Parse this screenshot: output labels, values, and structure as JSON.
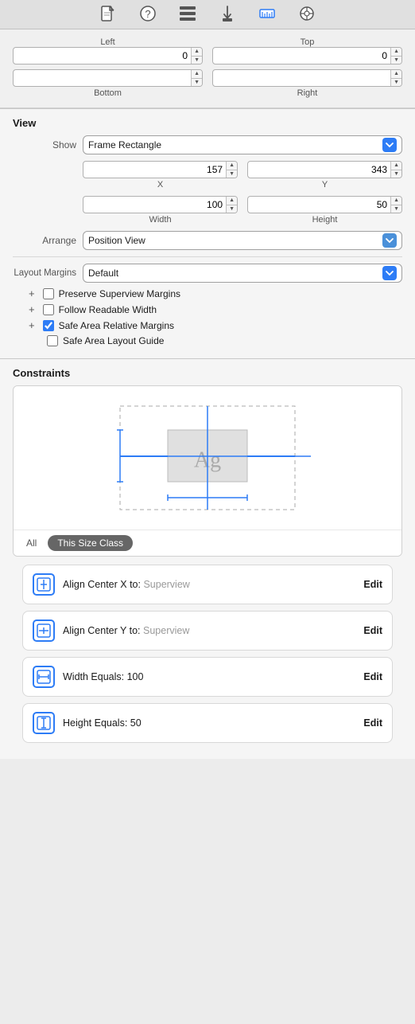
{
  "toolbar": {
    "icons": [
      {
        "name": "document-icon",
        "symbol": "📄",
        "active": false
      },
      {
        "name": "help-icon",
        "symbol": "?",
        "active": false,
        "circle": true
      },
      {
        "name": "list-icon",
        "symbol": "▤",
        "active": false
      },
      {
        "name": "connect-icon",
        "symbol": "⬇",
        "active": false
      },
      {
        "name": "ruler-icon",
        "symbol": "📐",
        "active": true
      },
      {
        "name": "link-icon",
        "symbol": "⊙",
        "active": false
      }
    ]
  },
  "top_fields": {
    "left_label": "Left",
    "top_label": "Top",
    "bottom_label": "Bottom",
    "right_label": "Right",
    "left_value": "0",
    "top_value": "0",
    "bottom_value": "",
    "right_value": ""
  },
  "view_section": {
    "title": "View",
    "show_label": "Show",
    "show_value": "Frame Rectangle",
    "x_label": "X",
    "y_label": "Y",
    "x_value": "157",
    "y_value": "343",
    "width_label": "Width",
    "height_label": "Height",
    "width_value": "100",
    "height_value": "50",
    "arrange_label": "Arrange",
    "arrange_value": "Position View",
    "layout_margins_label": "Layout Margins",
    "layout_margins_value": "Default",
    "checkboxes": [
      {
        "id": "preserve",
        "label": "Preserve Superview Margins",
        "checked": false,
        "has_plus": true
      },
      {
        "id": "readable",
        "label": "Follow Readable Width",
        "checked": false,
        "has_plus": true
      },
      {
        "id": "safe_relative",
        "label": "Safe Area Relative Margins",
        "checked": true,
        "has_plus": true
      },
      {
        "id": "safe_layout",
        "label": "Safe Area Layout Guide",
        "checked": false,
        "has_plus": false
      }
    ]
  },
  "constraints_section": {
    "title": "Constraints",
    "tabs": {
      "all_label": "All",
      "size_class_label": "This Size Class"
    },
    "items": [
      {
        "icon_type": "center-x",
        "text": "Align Center X to:",
        "subtext": "Superview",
        "edit_label": "Edit"
      },
      {
        "icon_type": "center-y",
        "text": "Align Center Y to:",
        "subtext": "Superview",
        "edit_label": "Edit"
      },
      {
        "icon_type": "width",
        "text": "Width Equals:",
        "subtext": "100",
        "edit_label": "Edit"
      },
      {
        "icon_type": "height",
        "text": "Height Equals:",
        "subtext": "50",
        "edit_label": "Edit"
      }
    ]
  }
}
